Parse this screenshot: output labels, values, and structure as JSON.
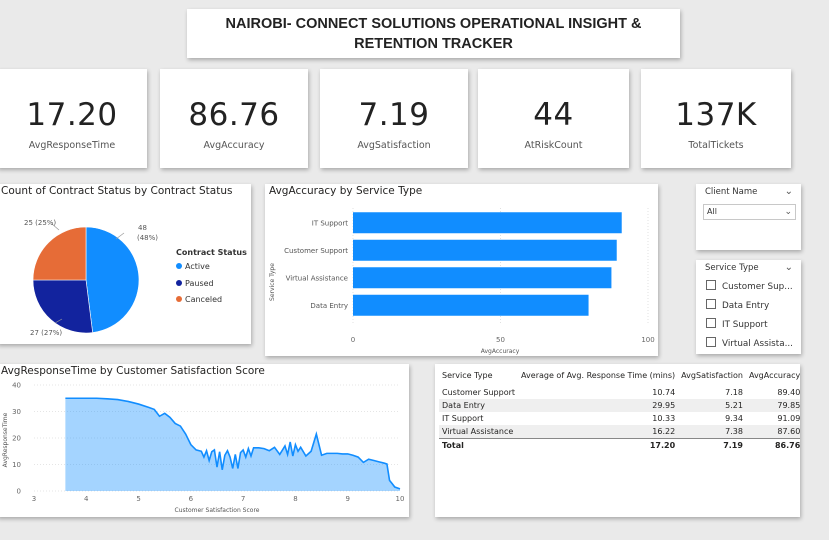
{
  "header": {
    "title": "NAIROBI- CONNECT SOLUTIONS OPERATIONAL INSIGHT & RETENTION TRACKER"
  },
  "kpis": [
    {
      "value": "17.20",
      "label": "AvgResponseTime"
    },
    {
      "value": "86.76",
      "label": "AvgAccuracy"
    },
    {
      "value": "7.19",
      "label": "AvgSatisfaction"
    },
    {
      "value": "44",
      "label": "AtRiskCount"
    },
    {
      "value": "137K",
      "label": "TotalTickets"
    }
  ],
  "slicers": {
    "client": {
      "title": "Client Name",
      "selected": "All"
    },
    "service": {
      "title": "Service Type",
      "options": [
        "Customer Sup...",
        "Data Entry",
        "IT Support",
        "Virtual Assista..."
      ]
    }
  },
  "table": {
    "headers": [
      "Service Type",
      "Average of Avg. Response Time (mins)",
      "AvgSatisfaction",
      "AvgAccuracy"
    ],
    "rows": [
      [
        "Customer Support",
        "10.74",
        "7.18",
        "89.40"
      ],
      [
        "Data Entry",
        "29.95",
        "5.21",
        "79.85"
      ],
      [
        "IT Support",
        "10.33",
        "9.34",
        "91.09"
      ],
      [
        "Virtual Assistance",
        "16.22",
        "7.38",
        "87.60"
      ]
    ],
    "total": [
      "Total",
      "17.20",
      "7.19",
      "86.76"
    ]
  },
  "chart_data": [
    {
      "type": "pie",
      "title": "Count of Contract Status by Contract Status",
      "legend_title": "Contract Status",
      "legend_position": "right",
      "slices": [
        {
          "name": "Active",
          "value": 48,
          "label": "48",
          "sublabel": "(48%)",
          "color": "#118DFF"
        },
        {
          "name": "Paused",
          "value": 27,
          "label": "27 (27%)",
          "color": "#12239E"
        },
        {
          "name": "Canceled",
          "value": 25,
          "label": "25 (25%)",
          "color": "#E66C37"
        }
      ]
    },
    {
      "type": "bar",
      "orientation": "horizontal",
      "title": "AvgAccuracy by Service Type",
      "xlabel": "AvgAccuracy",
      "ylabel": "Service Type",
      "xlim": [
        0,
        100
      ],
      "xticks": [
        "0",
        "50",
        "100"
      ],
      "categories": [
        "IT Support",
        "Customer Support",
        "Virtual Assistance",
        "Data Entry"
      ],
      "values": [
        91.09,
        89.4,
        87.6,
        79.85
      ],
      "color": "#118DFF"
    },
    {
      "type": "area",
      "title": "AvgResponseTime by Customer Satisfaction Score",
      "xlabel": "Customer Satisfaction Score",
      "ylabel": "AvgResponseTime",
      "xlim": [
        3,
        10
      ],
      "ylim": [
        0,
        40
      ],
      "xticks": [
        "3",
        "4",
        "5",
        "6",
        "7",
        "8",
        "9",
        "10"
      ],
      "yticks": [
        "0",
        "10",
        "20",
        "30",
        "40"
      ],
      "color": "#118DFF",
      "x": [
        3.6,
        3.8,
        4.0,
        4.2,
        4.4,
        4.6,
        4.8,
        5.0,
        5.2,
        5.3,
        5.4,
        5.5,
        5.6,
        5.7,
        5.8,
        5.9,
        6.0,
        6.1,
        6.2,
        6.25,
        6.3,
        6.35,
        6.4,
        6.45,
        6.5,
        6.55,
        6.6,
        6.65,
        6.7,
        6.75,
        6.8,
        6.85,
        6.9,
        6.95,
        7.0,
        7.05,
        7.1,
        7.15,
        7.2,
        7.3,
        7.4,
        7.5,
        7.6,
        7.7,
        7.8,
        7.85,
        7.9,
        7.95,
        8.0,
        8.05,
        8.1,
        8.2,
        8.3,
        8.4,
        8.5,
        8.6,
        8.7,
        8.8,
        8.9,
        9.0,
        9.1,
        9.2,
        9.3,
        9.4,
        9.5,
        9.6,
        9.7,
        9.75,
        9.8,
        9.85,
        9.9,
        10.0
      ],
      "y": [
        35,
        35,
        35,
        35,
        34.8,
        34.5,
        33.8,
        32.8,
        31.5,
        30.8,
        28.2,
        29.3,
        27.8,
        25.5,
        24.5,
        21.5,
        17.5,
        15.5,
        15.0,
        12.8,
        15.2,
        11.5,
        14.8,
        15.5,
        9.0,
        14.8,
        8.0,
        13.5,
        15.2,
        12.8,
        8.5,
        13.8,
        8.5,
        14.5,
        15.5,
        12.8,
        16.0,
        13.2,
        16.3,
        16.3,
        16.0,
        15.2,
        16.5,
        13.8,
        17.0,
        13.8,
        18.5,
        13.2,
        17.5,
        15.0,
        16.5,
        13.2,
        15.0,
        21.5,
        13.5,
        14.2,
        14.2,
        14.2,
        14.0,
        14.0,
        13.5,
        12.8,
        10.8,
        12.0,
        11.5,
        11.0,
        10.5,
        10.2,
        4.0,
        2.8,
        1.5,
        0.8
      ]
    }
  ]
}
